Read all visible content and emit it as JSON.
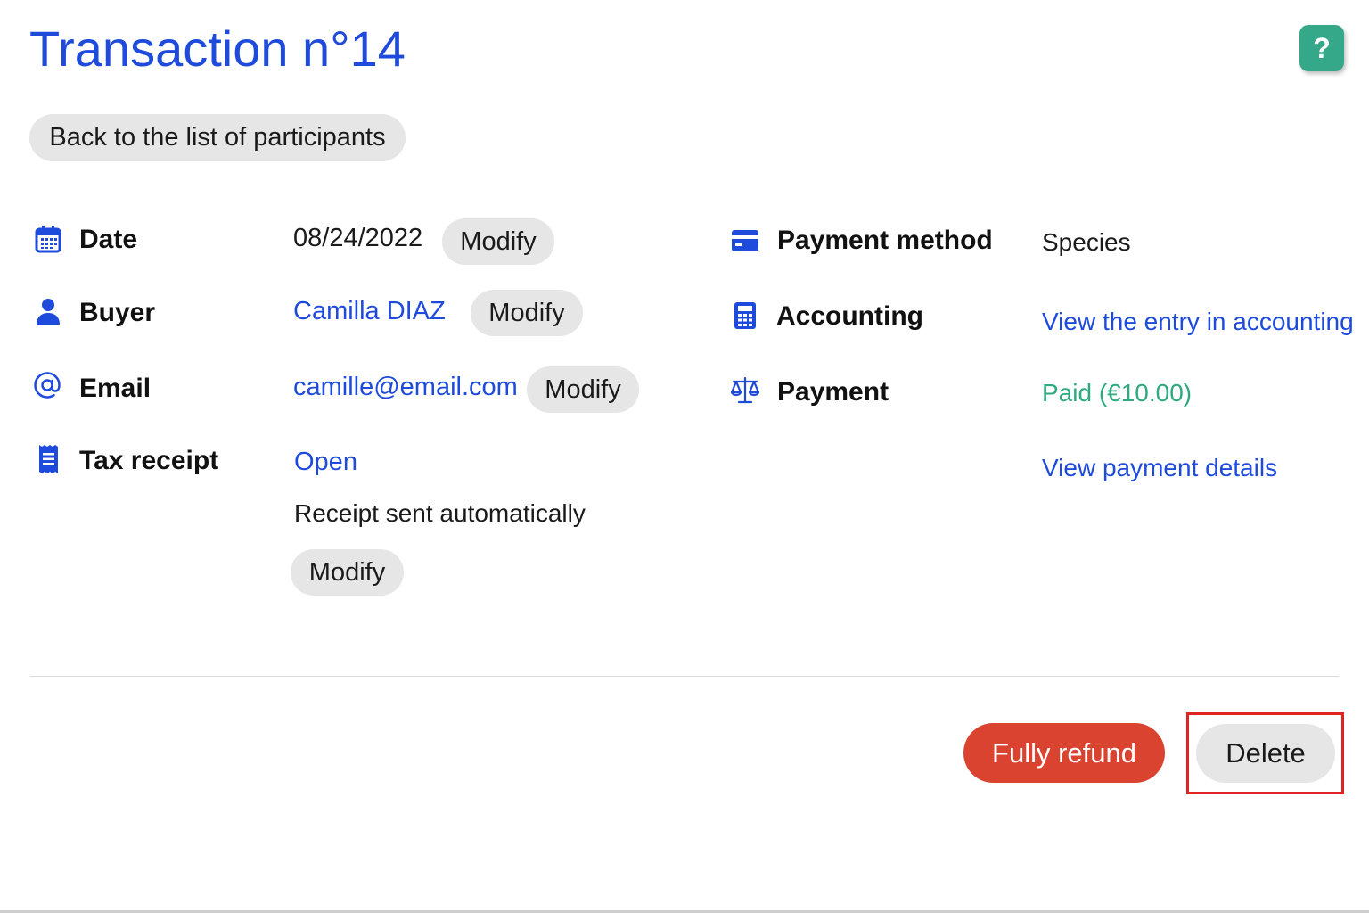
{
  "page": {
    "title": "Transaction n°14",
    "help_label": "?",
    "back_label": "Back to the list of participants"
  },
  "left_rows": {
    "date": {
      "label": "Date",
      "value": "08/24/2022",
      "modify_label": "Modify"
    },
    "buyer": {
      "label": "Buyer",
      "value": "Camilla DIAZ",
      "modify_label": "Modify"
    },
    "email": {
      "label": "Email",
      "value": "camille@email.com",
      "modify_label": "Modify"
    },
    "tax_receipt": {
      "label": "Tax receipt",
      "open_label": "Open",
      "status": "Receipt sent automatically",
      "modify_label": "Modify"
    }
  },
  "right_rows": {
    "payment_method": {
      "label": "Payment method",
      "value": "Species"
    },
    "accounting": {
      "label": "Accounting",
      "link": "View the entry in accounting"
    },
    "payment": {
      "label": "Payment",
      "status": "Paid (€10.00)",
      "details_link": "View payment details"
    }
  },
  "actions": {
    "refund_label": "Fully refund",
    "delete_label": "Delete"
  },
  "colors": {
    "accent": "#1f4bdc",
    "success": "#2eaa7c",
    "danger": "#d9432f",
    "help": "#34a888"
  },
  "icons": {
    "date": "calendar-icon",
    "buyer": "user-icon",
    "email": "at-icon",
    "tax_receipt": "receipt-icon",
    "payment_method": "credit-card-icon",
    "accounting": "calculator-icon",
    "payment": "scale-icon"
  }
}
